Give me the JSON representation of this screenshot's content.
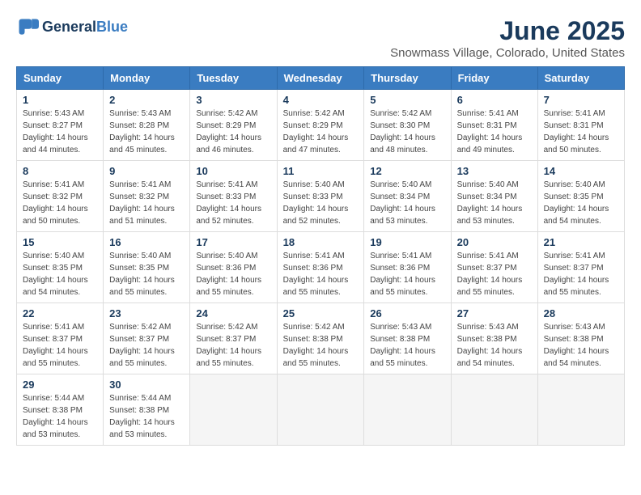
{
  "header": {
    "logo_line1": "General",
    "logo_line2": "Blue",
    "month_title": "June 2025",
    "subtitle": "Snowmass Village, Colorado, United States"
  },
  "days_of_week": [
    "Sunday",
    "Monday",
    "Tuesday",
    "Wednesday",
    "Thursday",
    "Friday",
    "Saturday"
  ],
  "weeks": [
    [
      {
        "day": "1",
        "sunrise": "5:43 AM",
        "sunset": "8:27 PM",
        "daylight": "14 hours and 44 minutes."
      },
      {
        "day": "2",
        "sunrise": "5:43 AM",
        "sunset": "8:28 PM",
        "daylight": "14 hours and 45 minutes."
      },
      {
        "day": "3",
        "sunrise": "5:42 AM",
        "sunset": "8:29 PM",
        "daylight": "14 hours and 46 minutes."
      },
      {
        "day": "4",
        "sunrise": "5:42 AM",
        "sunset": "8:29 PM",
        "daylight": "14 hours and 47 minutes."
      },
      {
        "day": "5",
        "sunrise": "5:42 AM",
        "sunset": "8:30 PM",
        "daylight": "14 hours and 48 minutes."
      },
      {
        "day": "6",
        "sunrise": "5:41 AM",
        "sunset": "8:31 PM",
        "daylight": "14 hours and 49 minutes."
      },
      {
        "day": "7",
        "sunrise": "5:41 AM",
        "sunset": "8:31 PM",
        "daylight": "14 hours and 50 minutes."
      }
    ],
    [
      {
        "day": "8",
        "sunrise": "5:41 AM",
        "sunset": "8:32 PM",
        "daylight": "14 hours and 50 minutes."
      },
      {
        "day": "9",
        "sunrise": "5:41 AM",
        "sunset": "8:32 PM",
        "daylight": "14 hours and 51 minutes."
      },
      {
        "day": "10",
        "sunrise": "5:41 AM",
        "sunset": "8:33 PM",
        "daylight": "14 hours and 52 minutes."
      },
      {
        "day": "11",
        "sunrise": "5:40 AM",
        "sunset": "8:33 PM",
        "daylight": "14 hours and 52 minutes."
      },
      {
        "day": "12",
        "sunrise": "5:40 AM",
        "sunset": "8:34 PM",
        "daylight": "14 hours and 53 minutes."
      },
      {
        "day": "13",
        "sunrise": "5:40 AM",
        "sunset": "8:34 PM",
        "daylight": "14 hours and 53 minutes."
      },
      {
        "day": "14",
        "sunrise": "5:40 AM",
        "sunset": "8:35 PM",
        "daylight": "14 hours and 54 minutes."
      }
    ],
    [
      {
        "day": "15",
        "sunrise": "5:40 AM",
        "sunset": "8:35 PM",
        "daylight": "14 hours and 54 minutes."
      },
      {
        "day": "16",
        "sunrise": "5:40 AM",
        "sunset": "8:35 PM",
        "daylight": "14 hours and 55 minutes."
      },
      {
        "day": "17",
        "sunrise": "5:40 AM",
        "sunset": "8:36 PM",
        "daylight": "14 hours and 55 minutes."
      },
      {
        "day": "18",
        "sunrise": "5:41 AM",
        "sunset": "8:36 PM",
        "daylight": "14 hours and 55 minutes."
      },
      {
        "day": "19",
        "sunrise": "5:41 AM",
        "sunset": "8:36 PM",
        "daylight": "14 hours and 55 minutes."
      },
      {
        "day": "20",
        "sunrise": "5:41 AM",
        "sunset": "8:37 PM",
        "daylight": "14 hours and 55 minutes."
      },
      {
        "day": "21",
        "sunrise": "5:41 AM",
        "sunset": "8:37 PM",
        "daylight": "14 hours and 55 minutes."
      }
    ],
    [
      {
        "day": "22",
        "sunrise": "5:41 AM",
        "sunset": "8:37 PM",
        "daylight": "14 hours and 55 minutes."
      },
      {
        "day": "23",
        "sunrise": "5:42 AM",
        "sunset": "8:37 PM",
        "daylight": "14 hours and 55 minutes."
      },
      {
        "day": "24",
        "sunrise": "5:42 AM",
        "sunset": "8:37 PM",
        "daylight": "14 hours and 55 minutes."
      },
      {
        "day": "25",
        "sunrise": "5:42 AM",
        "sunset": "8:38 PM",
        "daylight": "14 hours and 55 minutes."
      },
      {
        "day": "26",
        "sunrise": "5:43 AM",
        "sunset": "8:38 PM",
        "daylight": "14 hours and 55 minutes."
      },
      {
        "day": "27",
        "sunrise": "5:43 AM",
        "sunset": "8:38 PM",
        "daylight": "14 hours and 54 minutes."
      },
      {
        "day": "28",
        "sunrise": "5:43 AM",
        "sunset": "8:38 PM",
        "daylight": "14 hours and 54 minutes."
      }
    ],
    [
      {
        "day": "29",
        "sunrise": "5:44 AM",
        "sunset": "8:38 PM",
        "daylight": "14 hours and 53 minutes."
      },
      {
        "day": "30",
        "sunrise": "5:44 AM",
        "sunset": "8:38 PM",
        "daylight": "14 hours and 53 minutes."
      },
      null,
      null,
      null,
      null,
      null
    ]
  ]
}
